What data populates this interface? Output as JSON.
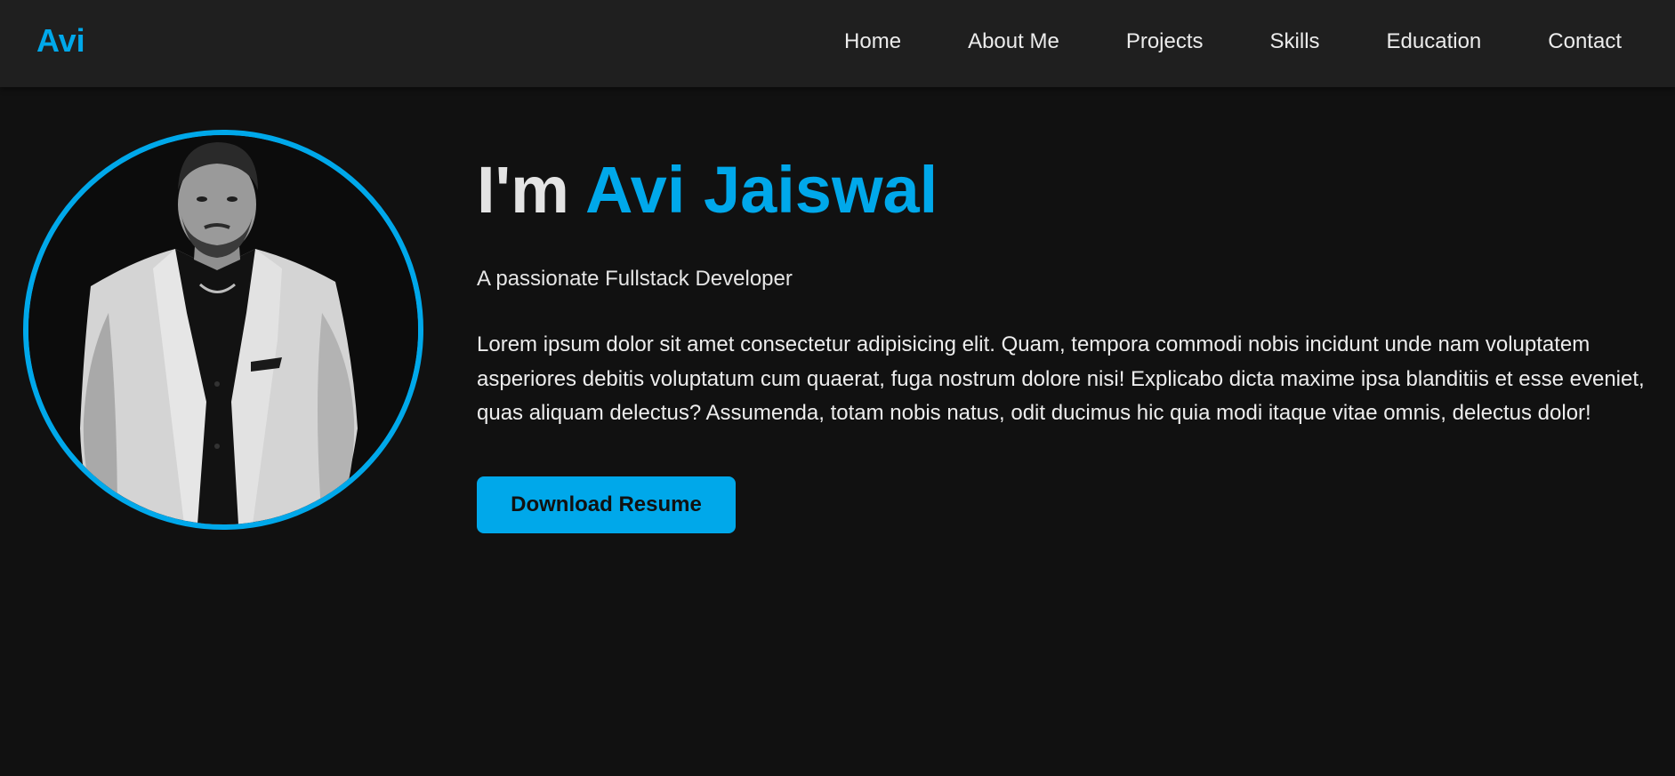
{
  "theme": {
    "accent": "#00a8ea",
    "background": "#111111",
    "navbar_background": "#1f1f1f"
  },
  "navbar": {
    "logo": "Avi",
    "links": [
      {
        "label": "Home"
      },
      {
        "label": "About Me"
      },
      {
        "label": "Projects"
      },
      {
        "label": "Skills"
      },
      {
        "label": "Education"
      },
      {
        "label": "Contact"
      }
    ]
  },
  "hero": {
    "title_prefix": "I'm",
    "title_name": "Avi Jaiswal",
    "subtitle": "A passionate Fullstack Developer",
    "description": "Lorem ipsum dolor sit amet consectetur adipisicing elit. Quam, tempora commodi nobis incidunt unde nam voluptatem asperiores debitis voluptatum cum quaerat, fuga nostrum dolore nisi! Explicabo dicta maxime ipsa blanditiis et esse eveniet, quas aliquam delectus? Assumenda, totam nobis natus, odit ducimus hic quia modi itaque vitae omnis, delectus dolor!",
    "button_label": "Download Resume",
    "photo": {
      "icon": "profile-photo",
      "style": "black-and-white portrait"
    }
  }
}
